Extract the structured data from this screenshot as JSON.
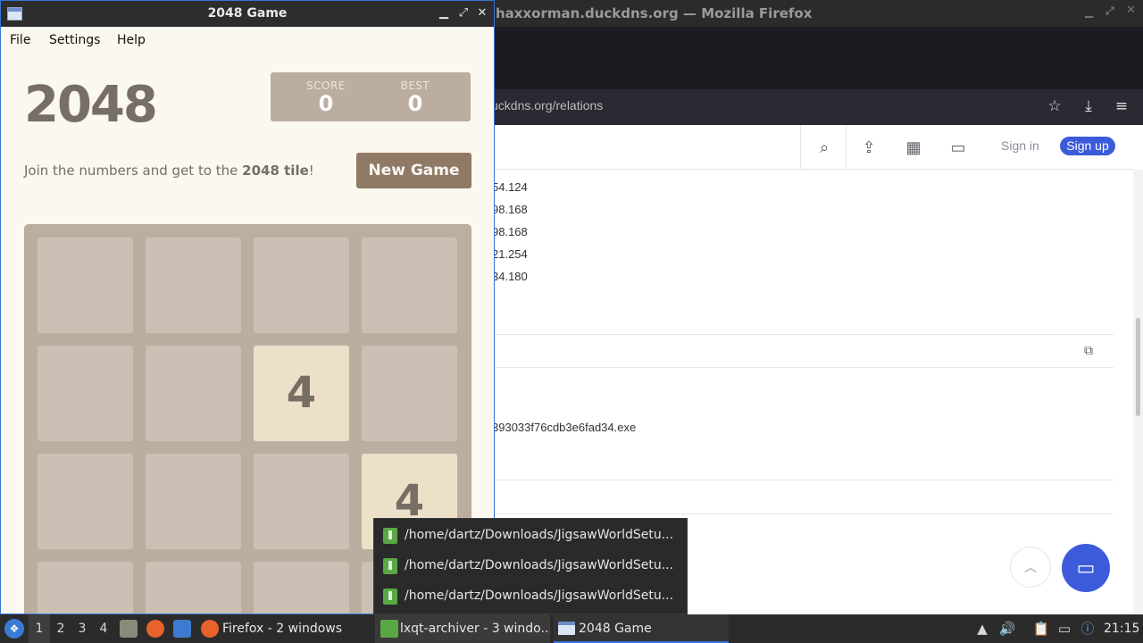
{
  "firefox": {
    "window_title": "haxxorman.duckdns.org — Mozilla Firefox",
    "url": "uckdns.org/relations",
    "nav_icons": [
      "star-icon",
      "download-icon",
      "menu-icon"
    ],
    "site_header": {
      "icons": [
        "search-icon",
        "upload-icon",
        "grid-icon",
        "chat-icon"
      ],
      "sign_in": "Sign in",
      "sign_up": "Sign up",
      "accent": "#3b5bdb"
    },
    "ip_rows": [
      "54.124",
      "98.168",
      "98.168",
      "21.254",
      "34.180"
    ],
    "file_name": "393033f76cdb3e6fad34.exe"
  },
  "game": {
    "window_title": "2048 Game",
    "menu": [
      "File",
      "Settings",
      "Help"
    ],
    "title": "2048",
    "score_label": "SCORE",
    "score": "0",
    "best_label": "BEST",
    "best": "0",
    "intro_prefix": "Join the numbers and get to the ",
    "intro_bold": "2048 tile",
    "intro_suffix": "!",
    "new_game": "New Game",
    "tiles": [
      {
        "row": 1,
        "col": 2,
        "value": "4"
      },
      {
        "row": 2,
        "col": 3,
        "value": "4"
      }
    ]
  },
  "popup": {
    "items": [
      "/home/dartz/Downloads/JigsawWorldSetu...",
      "/home/dartz/Downloads/JigsawWorldSetu...",
      "/home/dartz/Downloads/JigsawWorldSetu..."
    ]
  },
  "taskbar": {
    "desktops": [
      "1",
      "2",
      "3",
      "4"
    ],
    "tasks": [
      {
        "label": "Firefox - 2 windows"
      },
      {
        "label": "lxqt-archiver - 3 windo..."
      },
      {
        "label": "2048 Game"
      }
    ],
    "clock": "21:15"
  }
}
